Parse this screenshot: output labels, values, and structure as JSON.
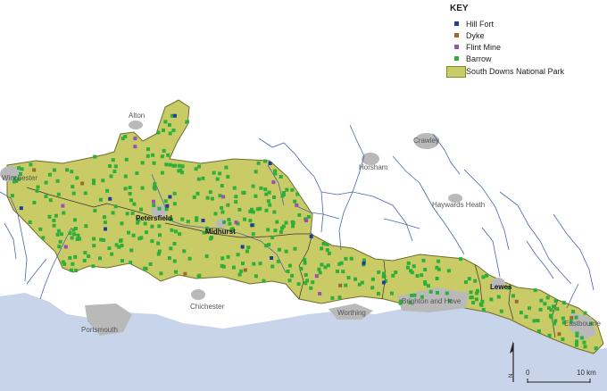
{
  "legend": {
    "title": "KEY",
    "items": [
      {
        "label": "Hill Fort",
        "color": "#1f3c99",
        "symbol": "square"
      },
      {
        "label": "Dyke",
        "color": "#9a6c2a",
        "symbol": "square"
      },
      {
        "label": "Flint Mine",
        "color": "#9b4fb0",
        "symbol": "square"
      },
      {
        "label": "Barrow",
        "color": "#2fae3a",
        "symbol": "square"
      },
      {
        "label": "South Downs National Park",
        "color": "#c9cb66",
        "symbol": "area"
      }
    ]
  },
  "places": {
    "alton": "Alton",
    "crawley": "Crawley",
    "horsham": "Horsham",
    "haywards_heath": "Haywards Heath",
    "winchester": "Winchester",
    "petersfield": "Petersfield",
    "midhurst": "Midhurst",
    "chichester": "Chichester",
    "portsmouth": "Portsmouth",
    "worthing": "Worthing",
    "brighton": "Brighton and Hove",
    "lewes": "Lewes",
    "eastbourne": "Eastbourne"
  },
  "scale_bar": {
    "start_label": "0",
    "end_label": "10 km"
  },
  "north_arrow": {
    "label": "N"
  },
  "colors": {
    "sea": "#c7d4ea",
    "park": "#c9cb66",
    "park_border": "#6b6f2a",
    "river": "#4a66a8",
    "urban": "#b9b9b9",
    "boundary": "#333333"
  }
}
